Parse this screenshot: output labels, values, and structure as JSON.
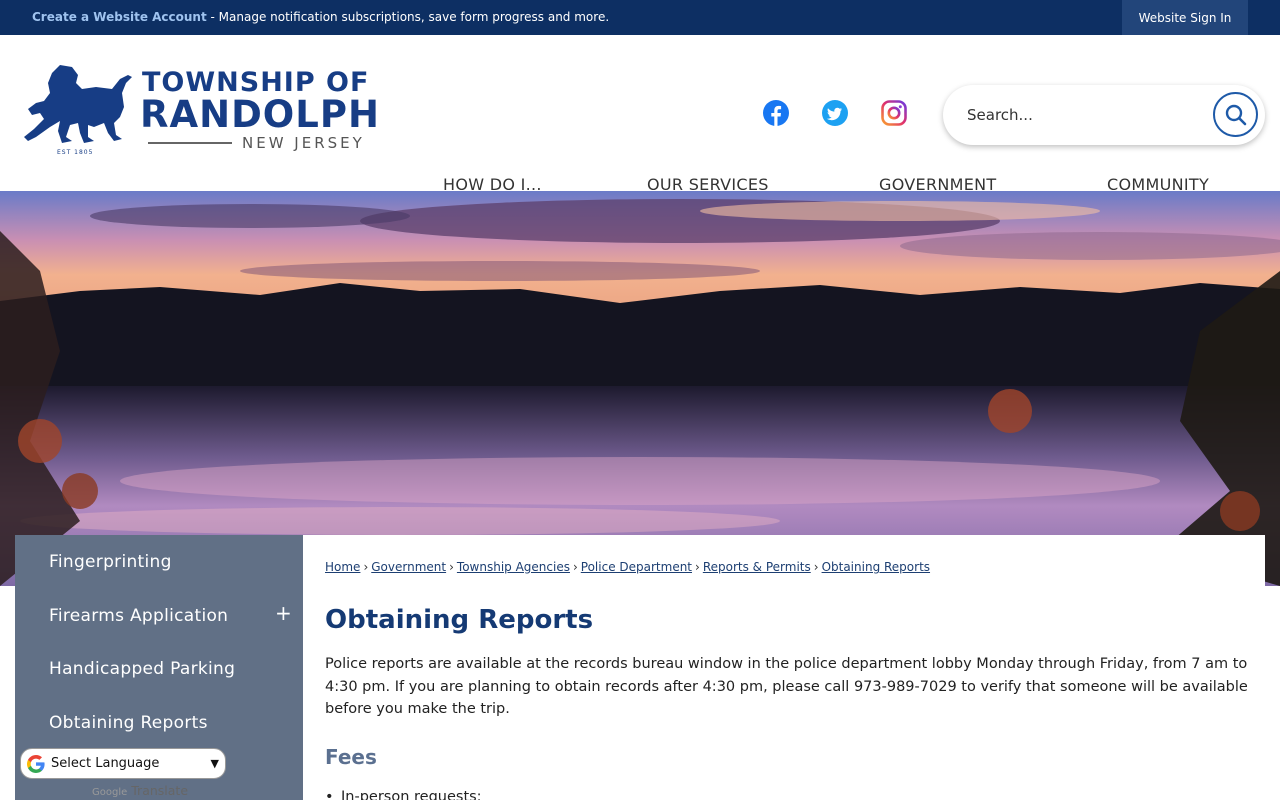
{
  "topbar": {
    "create_account": "Create a Website Account",
    "create_account_desc": " - Manage notification subscriptions, save form progress and more.",
    "sign_in": "Website Sign In"
  },
  "logo": {
    "line1": "TOWNSHIP OF",
    "line2": "RANDOLPH",
    "line3": "NEW JERSEY",
    "est": "EST 1805"
  },
  "social": [
    "facebook-icon",
    "twitter-icon",
    "instagram-icon"
  ],
  "search": {
    "placeholder": "Search..."
  },
  "nav": [
    "HOW DO I...",
    "OUR SERVICES",
    "GOVERNMENT",
    "COMMUNITY"
  ],
  "sidebar": {
    "items": [
      "Fingerprinting",
      "Firearms Application",
      "Handicapped Parking",
      "Obtaining Reports"
    ],
    "expand": "+"
  },
  "breadcrumb": [
    "Home",
    "Government",
    "Township Agencies",
    "Police Department",
    "Reports & Permits",
    "Obtaining Reports"
  ],
  "breadcrumb_sep": "›",
  "page": {
    "title": "Obtaining Reports",
    "body": "Police reports are available at the records bureau window in the police department lobby Monday through Friday, from 7 am to 4:30 pm. If you are planning to obtain records after 4:30 pm, please call 973-989-7029 to verify that someone will be available before you make the trip.",
    "fees_heading": "Fees",
    "fees_items": [
      "In-person requests:"
    ]
  },
  "translate": {
    "select_label": "Select Language",
    "powered_prefix": "Google",
    "powered_label": "Translate"
  },
  "colors": {
    "topbar": "#0d2f63",
    "brand_blue": "#173d85",
    "sidebar": "#617086",
    "title": "#153a74"
  }
}
